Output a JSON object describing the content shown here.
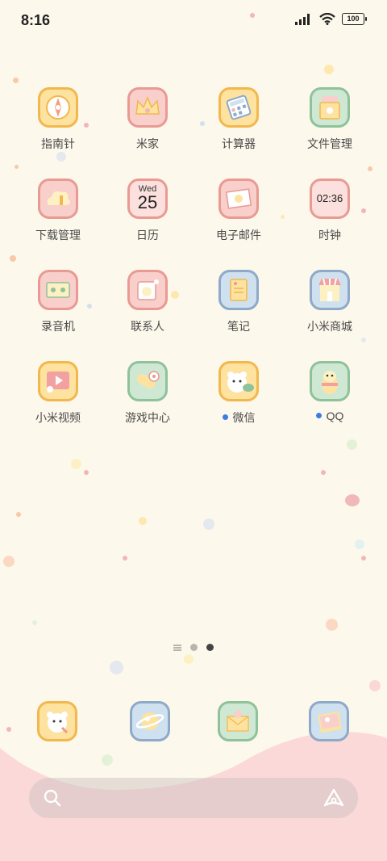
{
  "status_bar": {
    "time": "8:16",
    "battery": "100"
  },
  "apps": [
    {
      "label": "指南针",
      "icon": "compass-icon",
      "style": "y"
    },
    {
      "label": "米家",
      "icon": "crown-icon",
      "style": "p"
    },
    {
      "label": "计算器",
      "icon": "calculator-icon",
      "style": "y"
    },
    {
      "label": "文件管理",
      "icon": "folder-icon",
      "style": "g"
    },
    {
      "label": "下载管理",
      "icon": "cloud-download-icon",
      "style": "p"
    },
    {
      "label": "日历",
      "icon": "calendar-icon",
      "style": "p"
    },
    {
      "label": "电子邮件",
      "icon": "mail-icon",
      "style": "p"
    },
    {
      "label": "时钟",
      "icon": "clock-icon",
      "style": "p"
    },
    {
      "label": "录音机",
      "icon": "cassette-icon",
      "style": "p"
    },
    {
      "label": "联系人",
      "icon": "bear-contact-icon",
      "style": "p"
    },
    {
      "label": "笔记",
      "icon": "notepad-icon",
      "style": "b"
    },
    {
      "label": "小米商城",
      "icon": "shop-icon",
      "style": "b"
    },
    {
      "label": "小米视频",
      "icon": "video-play-icon",
      "style": "y"
    },
    {
      "label": "游戏中心",
      "icon": "game-controller-icon",
      "style": "g"
    },
    {
      "label": "微信",
      "icon": "wechat-bear-icon",
      "style": "y"
    },
    {
      "label": "QQ",
      "icon": "qq-penguin-icon",
      "style": "g"
    }
  ],
  "calendar": {
    "weekday": "Wed",
    "day": "25"
  },
  "clock": {
    "time": "02:36"
  },
  "dock": [
    {
      "icon": "phone-bear-icon",
      "style": "y"
    },
    {
      "icon": "browser-planet-icon",
      "style": "b"
    },
    {
      "icon": "messages-envelope-icon",
      "style": "g"
    },
    {
      "icon": "gallery-photo-icon",
      "style": "b"
    }
  ],
  "search": {
    "icon": "search-icon",
    "assistant_icon": "assistant-icon"
  },
  "colors": {
    "background": "#fdf8ec",
    "wave": "#fbd9d8",
    "notification_dot": "#3d7ce6"
  }
}
